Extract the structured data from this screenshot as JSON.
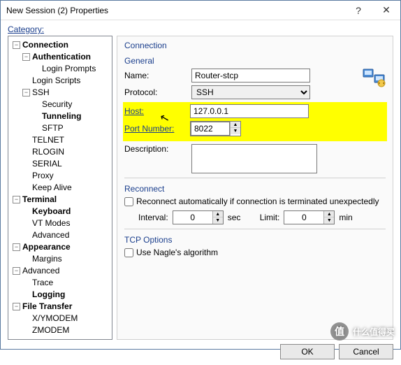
{
  "title": "New Session (2) Properties",
  "category_label": "Category:",
  "tree": {
    "connection": "Connection",
    "authentication": "Authentication",
    "login_prompts": "Login Prompts",
    "login_scripts": "Login Scripts",
    "ssh": "SSH",
    "security": "Security",
    "tunneling": "Tunneling",
    "sftp": "SFTP",
    "telnet": "TELNET",
    "rlogin": "RLOGIN",
    "serial": "SERIAL",
    "proxy": "Proxy",
    "keep_alive": "Keep Alive",
    "terminal": "Terminal",
    "keyboard": "Keyboard",
    "vt_modes": "VT Modes",
    "advanced_term": "Advanced",
    "appearance": "Appearance",
    "margins": "Margins",
    "advanced": "Advanced",
    "trace": "Trace",
    "logging": "Logging",
    "file_transfer": "File Transfer",
    "xymodem": "X/YMODEM",
    "zmodem": "ZMODEM"
  },
  "panel": {
    "title": "Connection",
    "general": "General",
    "name_label": "Name:",
    "name_value": "Router-stcp",
    "protocol_label": "Protocol:",
    "protocol_value": "SSH",
    "host_label": "Host:",
    "host_value": "127.0.0.1",
    "port_label": "Port Number:",
    "port_value": "8022",
    "description_label": "Description:",
    "description_value": "",
    "reconnect": "Reconnect",
    "reconnect_auto": "Reconnect automatically if connection is terminated unexpectedly",
    "interval_label": "Interval:",
    "interval_value": "0",
    "sec": "sec",
    "limit_label": "Limit:",
    "limit_value": "0",
    "min": "min",
    "tcp_options": "TCP Options",
    "nagle": "Use Nagle's algorithm"
  },
  "buttons": {
    "ok": "OK",
    "cancel": "Cancel"
  },
  "watermark": "什么值得买"
}
